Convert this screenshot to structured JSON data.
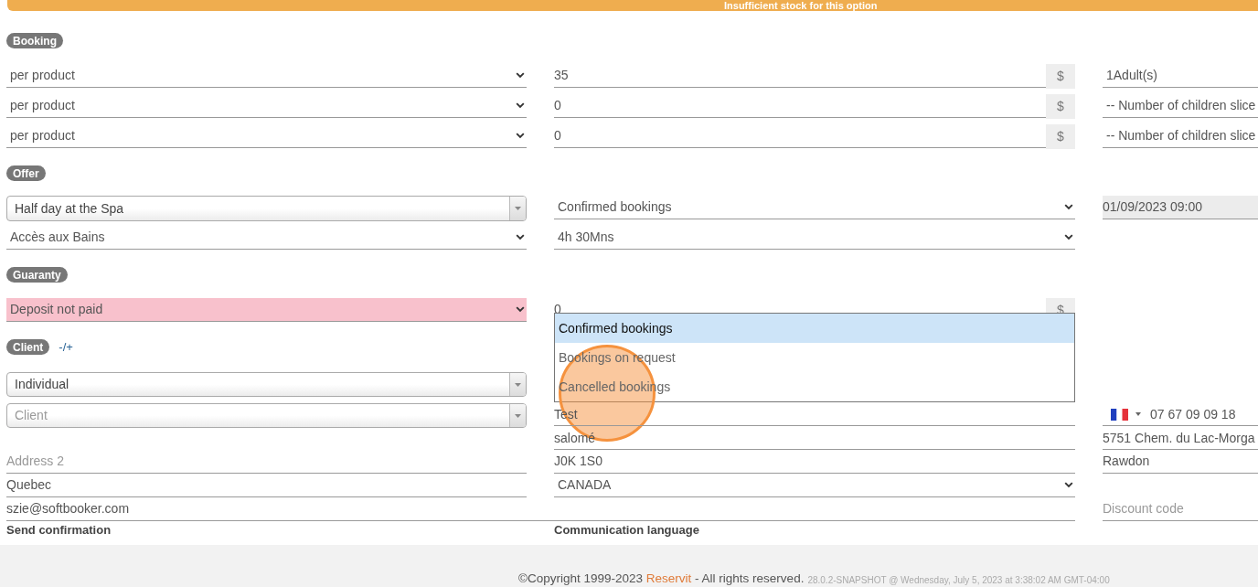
{
  "alert": {
    "text": "Insufficient stock for this option"
  },
  "booking": {
    "label": "Booking",
    "rows": [
      {
        "pricing": "per product",
        "amount": "35",
        "currency": "$",
        "guests": "1Adult(s)"
      },
      {
        "pricing": "per product",
        "amount": "0",
        "currency": "$",
        "guests": "-- Number of children slice"
      },
      {
        "pricing": "per product",
        "amount": "0",
        "currency": "$",
        "guests": "-- Number of children slice"
      }
    ]
  },
  "offer": {
    "label": "Offer",
    "product": "Half day at the Spa",
    "status": {
      "value": "Confirmed bookings",
      "expanded": true,
      "options": [
        {
          "label": "Confirmed bookings",
          "selected": true
        },
        {
          "label": "Bookings on request",
          "selected": false
        },
        {
          "label": "Cancelled bookings",
          "selected": false
        }
      ]
    },
    "date": "01/09/2023 09:00",
    "service": "Accès aux Bains",
    "duration": "4h 30Mns"
  },
  "guaranty": {
    "label": "Guaranty",
    "deposit": {
      "value": "Deposit not paid",
      "paid": false
    },
    "amount": "0",
    "currency": "$"
  },
  "client": {
    "label": "Client",
    "toggle": "-/+",
    "type": "Individual",
    "client_select": {
      "placeholder": "Client"
    },
    "last_name": "Test",
    "phone": "07 67 09 09 18",
    "first_name": "salomé",
    "address": "5751 Chem. du Lac-Morga",
    "address_2": {
      "placeholder": "Address 2"
    },
    "postal_code": "J0K 1S0",
    "city": "Rawdon",
    "region": "Quebec",
    "country": "CANADA",
    "email": "szie@softbooker.com",
    "discount_code": {
      "placeholder": "Discount code"
    }
  },
  "options": {
    "send_confirmation": "Send confirmation",
    "communication_language": "Communication language"
  },
  "footer": {
    "copyright": "©Copyright 1999-2023",
    "link": "Reservit",
    "rights": "- All rights reserved.",
    "version": "28.0.2-SNAPSHOT @ Wednesday, July 5, 2023 at 3:38:02 AM GMT-04:00"
  }
}
